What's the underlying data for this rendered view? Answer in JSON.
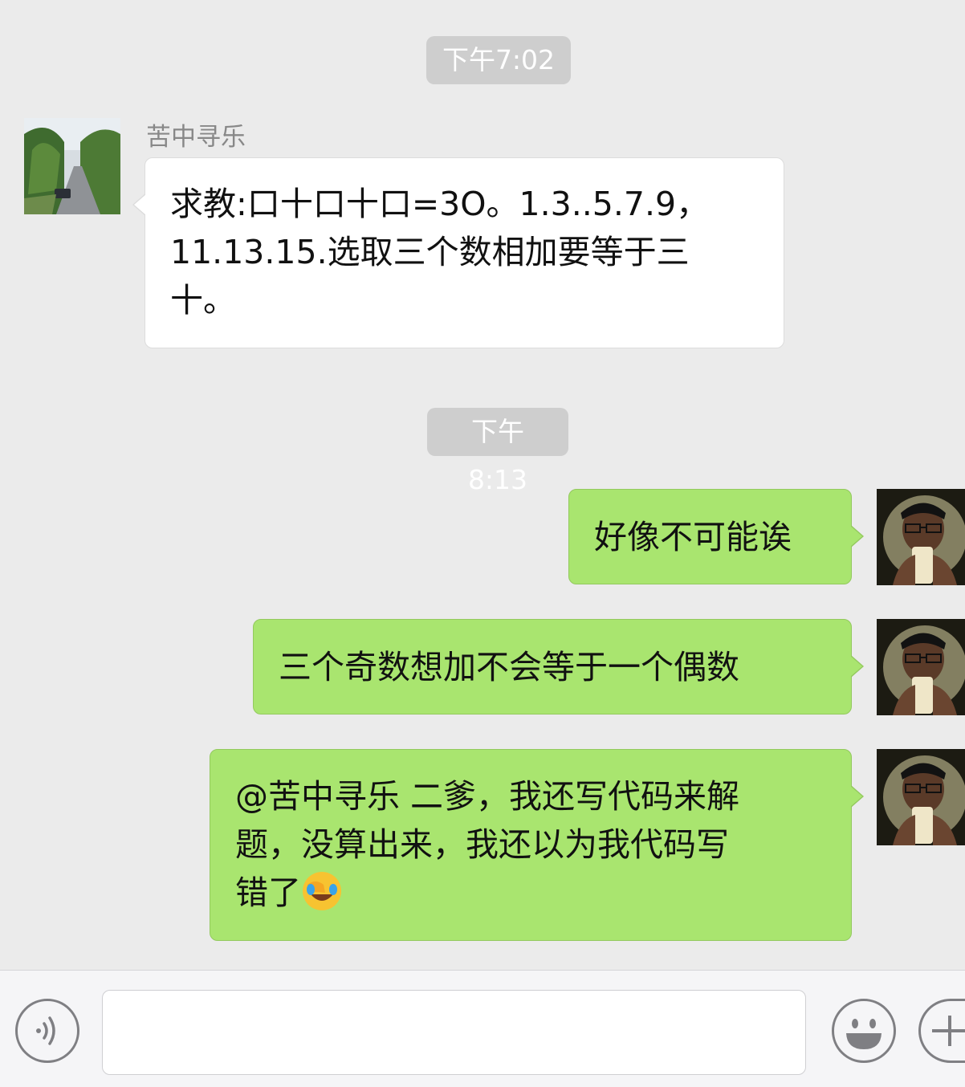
{
  "chat": {
    "timestamps": [
      "下午7:02",
      "下午8:13"
    ],
    "contact": {
      "name": "苦中寻乐",
      "avatar_icon": "landscape-road-photo-icon"
    },
    "me": {
      "avatar_icon": "person-selfie-photo-icon"
    },
    "messages": [
      {
        "from": "contact",
        "text": "求教:口十口十口=3O。1.3..5.7.9，\n11.13.15.选取三个数相加要等于三\n十。"
      },
      {
        "from": "me",
        "text": "好像不可能诶"
      },
      {
        "from": "me",
        "text": "三个奇数想加不会等于一个偶数"
      },
      {
        "from": "me",
        "text": "@苦中寻乐 二爹，我还写代码来解\n题，没算出来，我还以为我代码写\n错了",
        "emoji": "facepalm-laughing-emoji-icon"
      }
    ]
  },
  "input_bar": {
    "voice_icon": "voice-icon",
    "emoji_icon": "smiley-icon",
    "more_icon": "plus-icon",
    "placeholder": ""
  },
  "colors": {
    "background": "#ebebeb",
    "outgoing_bubble": "#a9e56f",
    "incoming_bubble": "#ffffff",
    "timestamp_bg": "#cecece"
  }
}
